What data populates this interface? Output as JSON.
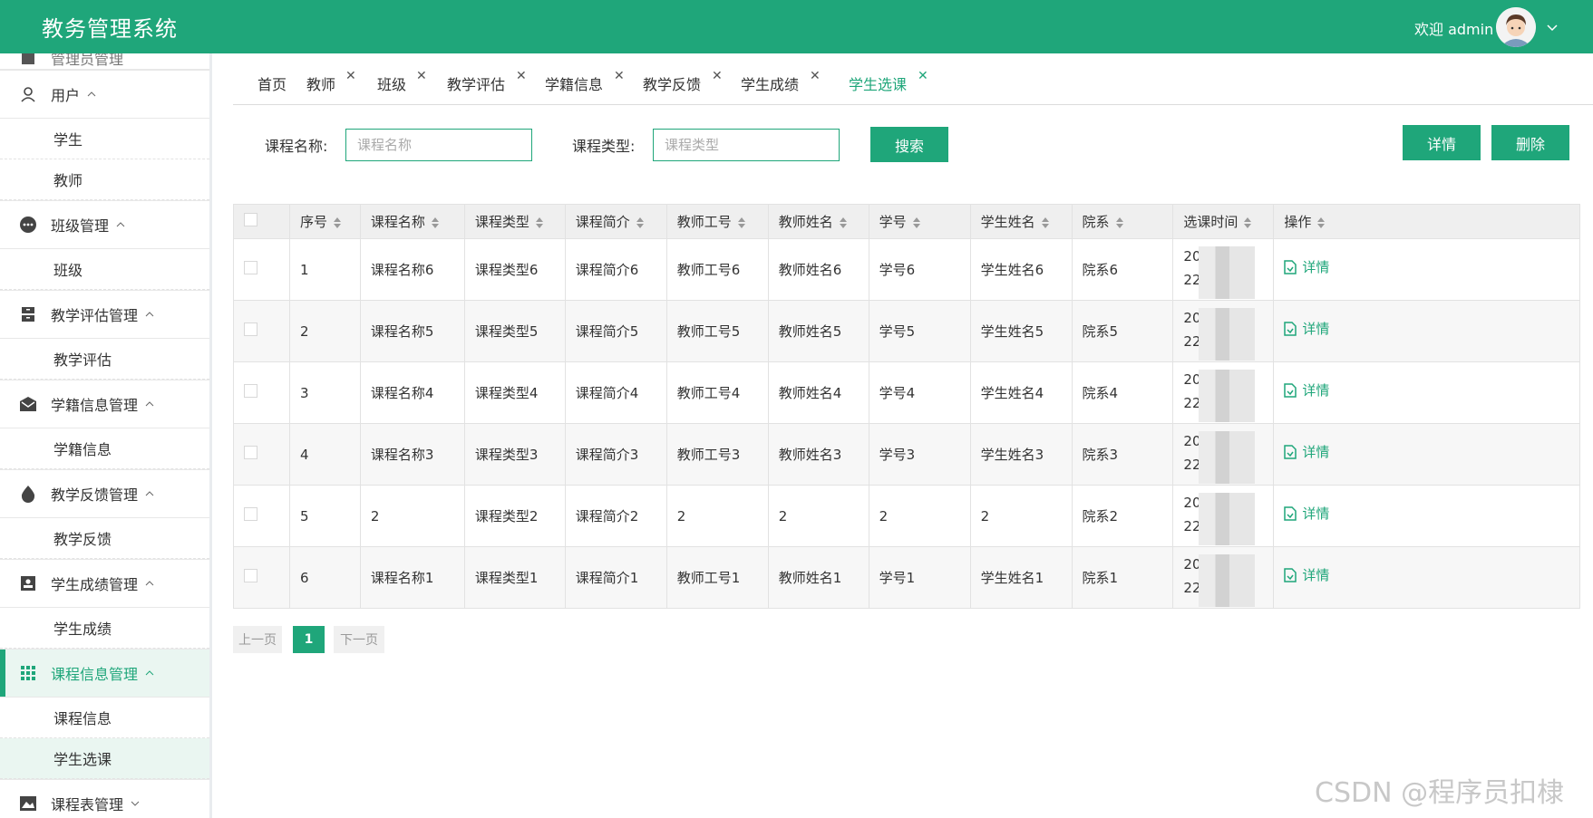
{
  "header": {
    "app_title": "教务管理系统",
    "welcome": "欢迎 admin",
    "bg_color": "#1fa67a"
  },
  "sidebar": {
    "top_partial": "管理员管理",
    "groups": [
      {
        "label": "用户",
        "icon": "user-icon",
        "expanded": true,
        "items": [
          "学生",
          "教师"
        ]
      },
      {
        "label": "班级管理",
        "icon": "more-icon",
        "expanded": true,
        "items": [
          "班级"
        ]
      },
      {
        "label": "教学评估管理",
        "icon": "archive-icon",
        "expanded": true,
        "items": [
          "教学评估"
        ]
      },
      {
        "label": "学籍信息管理",
        "icon": "mail-icon",
        "expanded": true,
        "items": [
          "学籍信息"
        ]
      },
      {
        "label": "教学反馈管理",
        "icon": "drop-icon",
        "expanded": true,
        "items": [
          "教学反馈"
        ]
      },
      {
        "label": "学生成绩管理",
        "icon": "id-card-icon",
        "expanded": true,
        "items": [
          "学生成绩"
        ]
      },
      {
        "label": "课程信息管理",
        "icon": "grid-icon",
        "expanded": true,
        "active": true,
        "items": [
          "课程信息",
          "学生选课"
        ]
      },
      {
        "label": "课程表管理",
        "icon": "calendar-icon",
        "expanded": false,
        "items": []
      }
    ]
  },
  "tabs": [
    {
      "label": "首页",
      "closable": false
    },
    {
      "label": "教师",
      "closable": true
    },
    {
      "label": "班级",
      "closable": true
    },
    {
      "label": "教学评估",
      "closable": true
    },
    {
      "label": "学籍信息",
      "closable": true
    },
    {
      "label": "教学反馈",
      "closable": true
    },
    {
      "label": "学生成绩",
      "closable": true
    },
    {
      "label": "学生选课",
      "closable": true,
      "active": true
    }
  ],
  "search": {
    "course_name_label": "课程名称:",
    "course_name_placeholder": "课程名称",
    "course_type_label": "课程类型:",
    "course_type_placeholder": "课程类型",
    "search_button": "搜索",
    "detail_button": "详情",
    "delete_button": "删除"
  },
  "table": {
    "columns": [
      "序号",
      "课程名称",
      "课程类型",
      "课程简介",
      "教师工号",
      "教师姓名",
      "学号",
      "学生姓名",
      "院系",
      "选课时间",
      "操作"
    ],
    "action_label": "详情",
    "rows": [
      [
        "1",
        "课程名称6",
        "课程类型6",
        "课程简介6",
        "教师工号6",
        "教师姓名6",
        "学号6",
        "学生姓名6",
        "院系6",
        "20",
        "22"
      ],
      [
        "2",
        "课程名称5",
        "课程类型5",
        "课程简介5",
        "教师工号5",
        "教师姓名5",
        "学号5",
        "学生姓名5",
        "院系5",
        "20",
        "22"
      ],
      [
        "3",
        "课程名称4",
        "课程类型4",
        "课程简介4",
        "教师工号4",
        "教师姓名4",
        "学号4",
        "学生姓名4",
        "院系4",
        "20",
        "22"
      ],
      [
        "4",
        "课程名称3",
        "课程类型3",
        "课程简介3",
        "教师工号3",
        "教师姓名3",
        "学号3",
        "学生姓名3",
        "院系3",
        "20",
        "22"
      ],
      [
        "5",
        "2",
        "课程类型2",
        "课程简介2",
        "2",
        "2",
        "2",
        "2",
        "院系2",
        "20",
        "22"
      ],
      [
        "6",
        "课程名称1",
        "课程类型1",
        "课程简介1",
        "教师工号1",
        "教师姓名1",
        "学号1",
        "学生姓名1",
        "院系1",
        "20",
        "22"
      ]
    ]
  },
  "pagination": {
    "prev": "上一页",
    "current": "1",
    "next": "下一页"
  },
  "watermark": "CSDN @程序员扣棣"
}
